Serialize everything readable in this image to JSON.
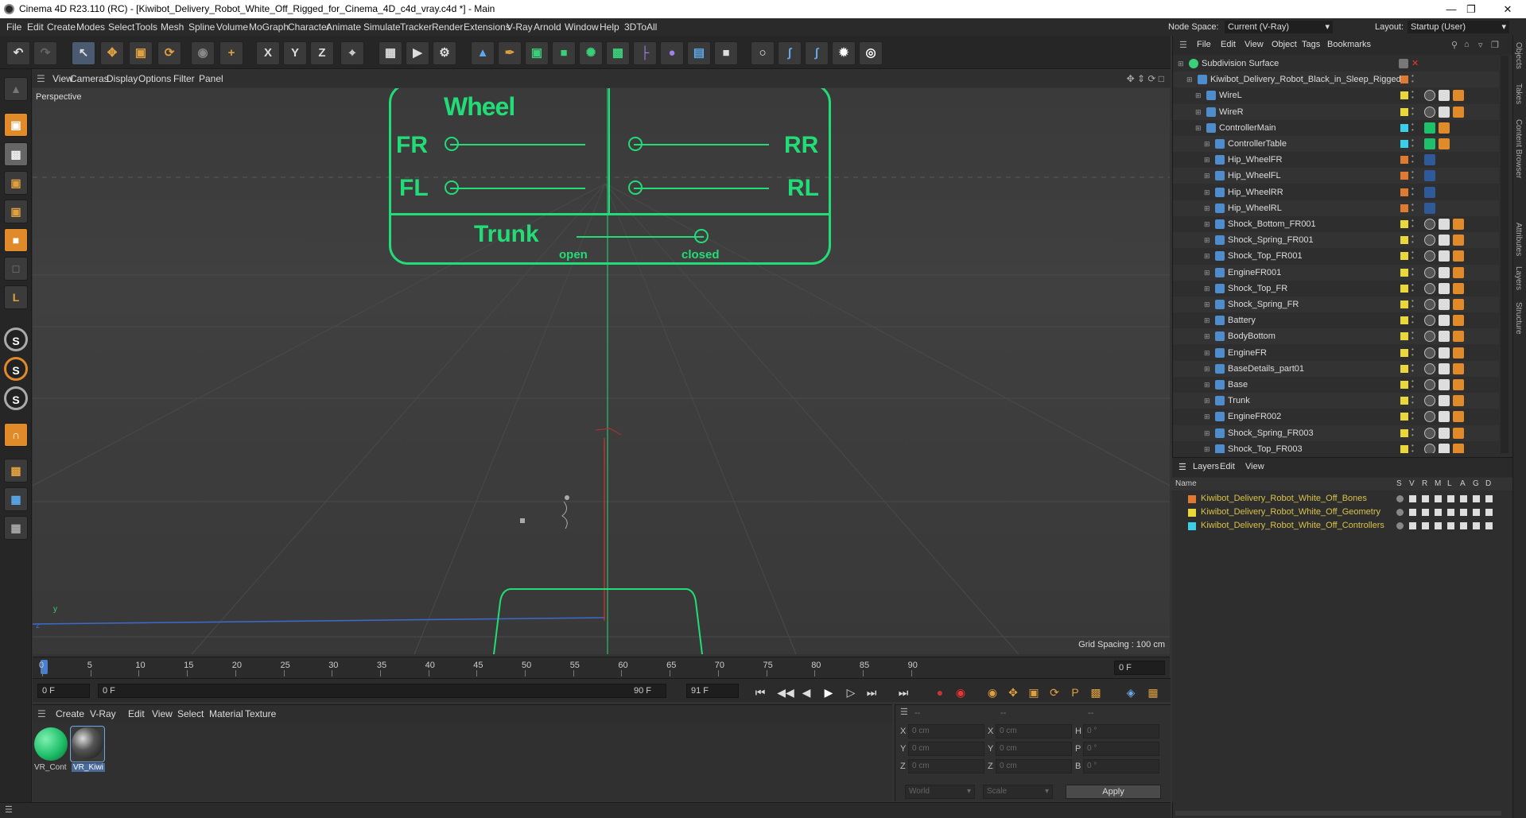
{
  "window": {
    "title": "Cinema 4D R23.110 (RC) - [Kiwibot_Delivery_Robot_White_Off_Rigged_for_Cinema_4D_c4d_vray.c4d *] - Main"
  },
  "menu": [
    "File",
    "Edit",
    "Create",
    "Modes",
    "Select",
    "Tools",
    "Mesh",
    "Spline",
    "Volume",
    "MoGraph",
    "Character",
    "Animate",
    "Simulate",
    "Tracker",
    "Render",
    "Extensions",
    "V-Ray",
    "Arnold",
    "Window",
    "Help",
    "3DToAll"
  ],
  "nodespace": {
    "label": "Node Space:",
    "value": "Current (V-Ray)"
  },
  "layout": {
    "label": "Layout:",
    "value": "Startup (User)"
  },
  "viewport": {
    "menu": [
      "View",
      "Cameras",
      "Display",
      "Options",
      "Filter",
      "Panel"
    ],
    "label": "Perspective",
    "grid_spacing": "Grid Spacing : 100 cm",
    "axis": {
      "y": "y",
      "z": "z"
    },
    "controller": {
      "wheel": "Wheel",
      "fr": "FR",
      "fl": "FL",
      "rr": "RR",
      "rl": "RL",
      "trunk": "Trunk",
      "open": "open",
      "closed": "closed"
    }
  },
  "timeline": {
    "ticks": [
      "0",
      "5",
      "10",
      "15",
      "20",
      "25",
      "30",
      "35",
      "40",
      "45",
      "50",
      "55",
      "60",
      "65",
      "70",
      "75",
      "80",
      "85",
      "90"
    ],
    "current": "0 F",
    "start": "0 F",
    "range_start": "0 F",
    "range_end": "90 F",
    "end": "91 F"
  },
  "material": {
    "menu": [
      "Create",
      "V-Ray",
      "Edit",
      "View",
      "Select",
      "Material",
      "Texture"
    ],
    "items": [
      {
        "name": "VR_Cont"
      },
      {
        "name": "VR_Kiwi"
      }
    ]
  },
  "coords": {
    "headers": [
      "--",
      "--",
      "--"
    ],
    "rows": [
      {
        "a": "X",
        "av": "0 cm",
        "b": "X",
        "bv": "0 cm",
        "c": "H",
        "cv": "0 °"
      },
      {
        "a": "Y",
        "av": "0 cm",
        "b": "Y",
        "bv": "0 cm",
        "c": "P",
        "cv": "0 °"
      },
      {
        "a": "Z",
        "av": "0 cm",
        "b": "Z",
        "bv": "0 cm",
        "c": "B",
        "cv": "0 °"
      }
    ],
    "mode": "World",
    "scale": "Scale",
    "apply": "Apply"
  },
  "objects": {
    "menu": [
      "File",
      "Edit",
      "View",
      "Object",
      "Tags",
      "Bookmarks"
    ],
    "items": [
      {
        "name": "Subdivision Surface",
        "indent": 0,
        "color": "#ffffff"
      },
      {
        "name": "Kiwibot_Delivery_Robot_Black_in_Sleep_Rigged",
        "indent": 1,
        "color": "#e07a30"
      },
      {
        "name": "WireL",
        "indent": 2,
        "color": "#e8d83a"
      },
      {
        "name": "WireR",
        "indent": 2,
        "color": "#e8d83a"
      },
      {
        "name": "ControllerMain",
        "indent": 2,
        "color": "#3ad0e8"
      },
      {
        "name": "ControllerTable",
        "indent": 3,
        "color": "#3ad0e8"
      },
      {
        "name": "Hip_WheelFR",
        "indent": 3,
        "color": "#e07a30"
      },
      {
        "name": "Hip_WheelFL",
        "indent": 3,
        "color": "#e07a30"
      },
      {
        "name": "Hip_WheelRR",
        "indent": 3,
        "color": "#e07a30"
      },
      {
        "name": "Hip_WheelRL",
        "indent": 3,
        "color": "#e07a30"
      },
      {
        "name": "Shock_Bottom_FR001",
        "indent": 3,
        "color": "#e8d83a"
      },
      {
        "name": "Shock_Spring_FR001",
        "indent": 3,
        "color": "#e8d83a"
      },
      {
        "name": "Shock_Top_FR001",
        "indent": 3,
        "color": "#e8d83a"
      },
      {
        "name": "EngineFR001",
        "indent": 3,
        "color": "#e8d83a"
      },
      {
        "name": "Shock_Top_FR",
        "indent": 3,
        "color": "#e8d83a"
      },
      {
        "name": "Shock_Spring_FR",
        "indent": 3,
        "color": "#e8d83a"
      },
      {
        "name": "Battery",
        "indent": 3,
        "color": "#e8d83a"
      },
      {
        "name": "BodyBottom",
        "indent": 3,
        "color": "#e8d83a"
      },
      {
        "name": "EngineFR",
        "indent": 3,
        "color": "#e8d83a"
      },
      {
        "name": "BaseDetails_part01",
        "indent": 3,
        "color": "#e8d83a"
      },
      {
        "name": "Base",
        "indent": 3,
        "color": "#e8d83a"
      },
      {
        "name": "Trunk",
        "indent": 3,
        "color": "#e8d83a"
      },
      {
        "name": "EngineFR002",
        "indent": 3,
        "color": "#e8d83a"
      },
      {
        "name": "Shock_Spring_FR003",
        "indent": 3,
        "color": "#e8d83a"
      },
      {
        "name": "Shock_Top_FR003",
        "indent": 3,
        "color": "#e8d83a"
      }
    ]
  },
  "layers": {
    "menu": [
      "Layers",
      "Edit",
      "View"
    ],
    "header": {
      "name": "Name",
      "flags": [
        "S",
        "V",
        "R",
        "M",
        "L",
        "A",
        "G",
        "D"
      ]
    },
    "items": [
      {
        "name": "Kiwibot_Delivery_Robot_White_Off_Bones",
        "color": "#e07a30"
      },
      {
        "name": "Kiwibot_Delivery_Robot_White_Off_Geometry",
        "color": "#e8d83a"
      },
      {
        "name": "Kiwibot_Delivery_Robot_White_Off_Controllers",
        "color": "#3ad0e8"
      }
    ]
  },
  "sidetabs": [
    "Objects",
    "Takes",
    "Content Browser",
    "Attributes",
    "Layers",
    "Structure"
  ],
  "accent": "#22dd77"
}
